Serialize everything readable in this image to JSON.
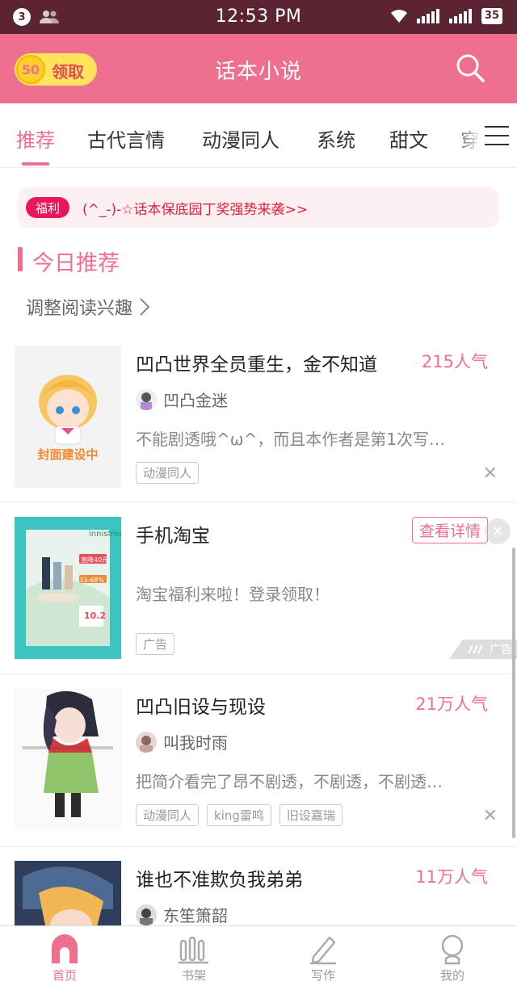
{
  "status_bar": {
    "notification_count": "3",
    "time": "12:53 PM",
    "battery": "35"
  },
  "header": {
    "coins": "50",
    "claim_label": "领取",
    "title": "话本小说"
  },
  "tabs": [
    {
      "label": "推荐"
    },
    {
      "label": "古代言情"
    },
    {
      "label": "动漫同人"
    },
    {
      "label": "系统"
    },
    {
      "label": "甜文"
    },
    {
      "label": "穿"
    }
  ],
  "notice": {
    "badge": "福利",
    "text": "(^_-)-☆话本保底园丁奖强势来袭>>"
  },
  "section": {
    "title": "今日推荐",
    "interest_link": "调整阅读兴趣"
  },
  "books": [
    {
      "title": "凹凸世界全员重生，金不知道",
      "popularity": "215人气",
      "author": "凹凸金迷",
      "description": "不能剧透哦^ω^，而且本作者是第1次写…",
      "tags": [
        "动漫同人"
      ],
      "cover_text": "封面建设中"
    },
    {
      "title": "凹凸旧设与现设",
      "popularity": "21万人气",
      "author": "叫我时雨",
      "description": "把简介看完了昂不剧透，不剧透，不剧透…",
      "tags": [
        "动漫同人",
        "king雷鸣",
        "旧设嘉瑞"
      ]
    },
    {
      "title": "谁也不准欺负我弟弟",
      "popularity": "11万人气",
      "author": "东笙箫韶"
    }
  ],
  "ad": {
    "title": "手机淘宝",
    "button": "查看详情",
    "description": "淘宝福利来啦！登录领取！",
    "tag": "广告",
    "mark": "广告",
    "cover_brand": "innisfree",
    "cover_price": "直降40元",
    "cover_discount": "33-68%",
    "cover_date": "10.2"
  },
  "bottom_nav": [
    {
      "label": "首页"
    },
    {
      "label": "书架"
    },
    {
      "label": "写作"
    },
    {
      "label": "我的"
    }
  ],
  "colors": {
    "accent": "#ef6f8e",
    "status_bar": "#5c2432",
    "notice_red": "#e01e3c",
    "badge_red": "#e8175d"
  }
}
